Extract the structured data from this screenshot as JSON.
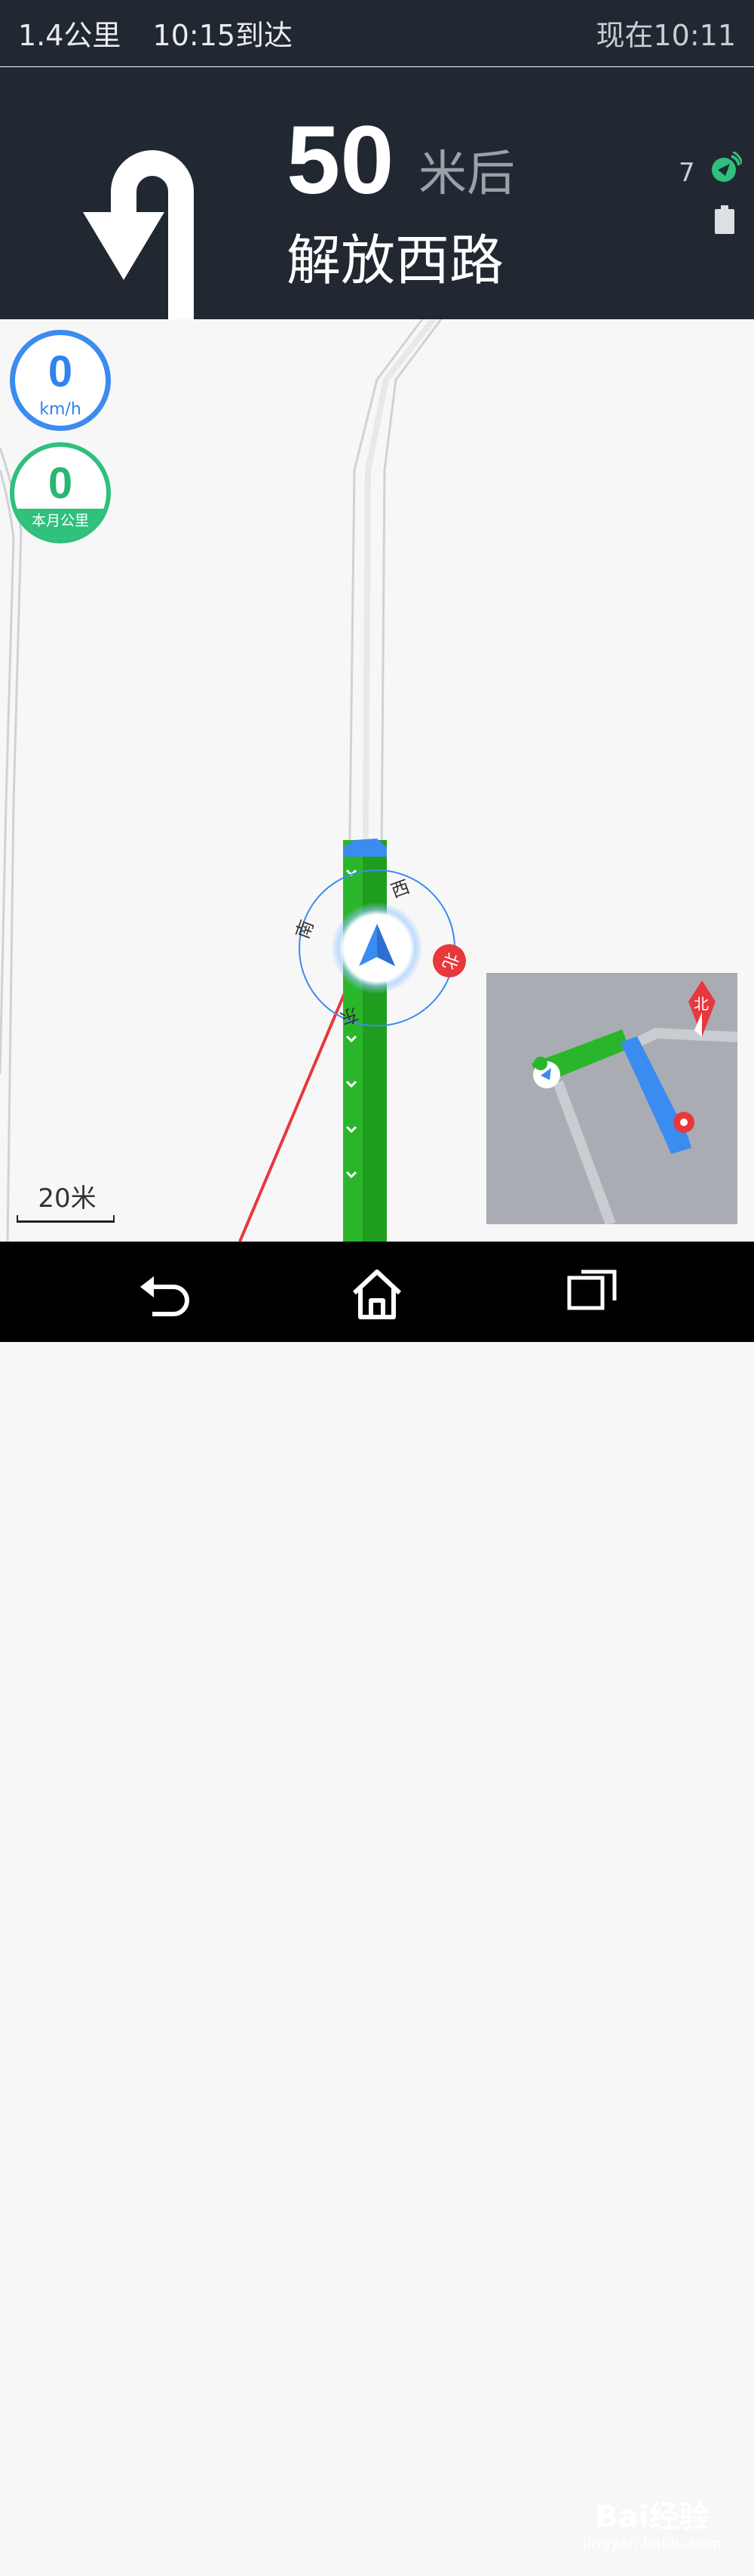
{
  "status_bar": {
    "distance": "1.4公里",
    "arrival": "10:15到达",
    "current_time": "现在10:11"
  },
  "guidance": {
    "distance_value": "50",
    "distance_unit": "米后",
    "road_name": "解放西路",
    "maneuver_icon": "u-turn-left-icon",
    "gps_satellites": "7"
  },
  "speed": {
    "value": "0",
    "unit": "km/h"
  },
  "mileage": {
    "value": "0",
    "label": "本月公里"
  },
  "compass": {
    "north": "北",
    "south": "南",
    "east": "东",
    "west": "西"
  },
  "scale": {
    "label": "20米"
  },
  "mini_map": {
    "north_label": "北"
  },
  "watermark": {
    "brand": "Bai经验",
    "url": "jingyan.baidu.com"
  },
  "colors": {
    "panel_bg": "#222831",
    "route_green": "#2ab62a",
    "route_blue": "#3b8cf0",
    "speed_blue": "#3b8cf0",
    "mileage_green": "#2fc07c",
    "north_red": "#e8383d"
  }
}
